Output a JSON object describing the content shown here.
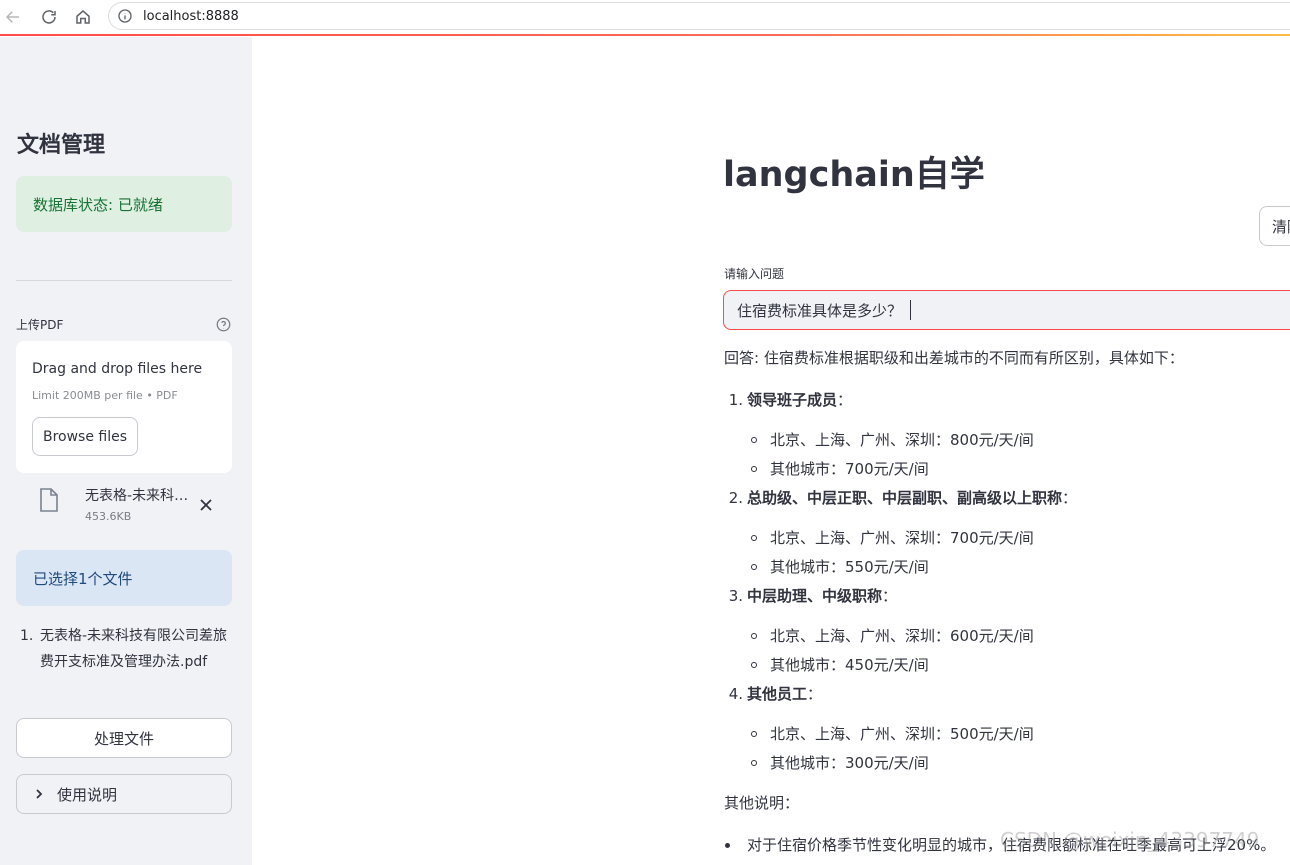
{
  "browser": {
    "url": "localhost:8888"
  },
  "sidebar": {
    "title": "文档管理",
    "db_status": "数据库状态: 已就绪",
    "upload_label": "上传PDF",
    "dropzone": {
      "title": "Drag and drop files here",
      "limit": "Limit 200MB per file • PDF",
      "browse_label": "Browse files"
    },
    "uploaded_file": {
      "name": "无表格-未来科技有限公司差旅费开支标准及管理办法.pdf",
      "size": "453.6KB"
    },
    "selected_info": "已选择1个文件",
    "file_list": [
      {
        "num": "1.",
        "name": "无表格-未来科技有限公司差旅费开支标准及管理办法.pdf"
      }
    ],
    "process_label": "处理文件",
    "instructions_label": "使用说明"
  },
  "main": {
    "title": "langchain自学",
    "clear_label": "清除",
    "input_label": "请输入问题",
    "question": "住宿费标准具体是多少？",
    "answer_intro": "回答: 住宿费标准根据职级和出差城市的不同而有所区别，具体如下：",
    "sections": [
      {
        "num": "1.",
        "heading": "领导班子成员",
        "colon": "：",
        "items": [
          "北京、上海、广州、深圳：800元/天/间",
          "其他城市：700元/天/间"
        ]
      },
      {
        "num": "2.",
        "heading": "总助级、中层正职、中层副职、副高级以上职称",
        "colon": "：",
        "items": [
          "北京、上海、广州、深圳：700元/天/间",
          "其他城市：550元/天/间"
        ]
      },
      {
        "num": "3.",
        "heading": "中层助理、中级职称",
        "colon": "：",
        "items": [
          "北京、上海、广州、深圳：600元/天/间",
          "其他城市：450元/天/间"
        ]
      },
      {
        "num": "4.",
        "heading": "其他员工",
        "colon": "：",
        "items": [
          "北京、上海、广州、深圳：500元/天/间",
          "其他城市：300元/天/间"
        ]
      }
    ],
    "other_notes_label": "其他说明：",
    "notes": [
      "对于住宿价格季节性变化明显的城市，住宿费限额标准在旺季最高可上浮20%。"
    ]
  },
  "watermark": "CSDN @weixin_43397749"
}
